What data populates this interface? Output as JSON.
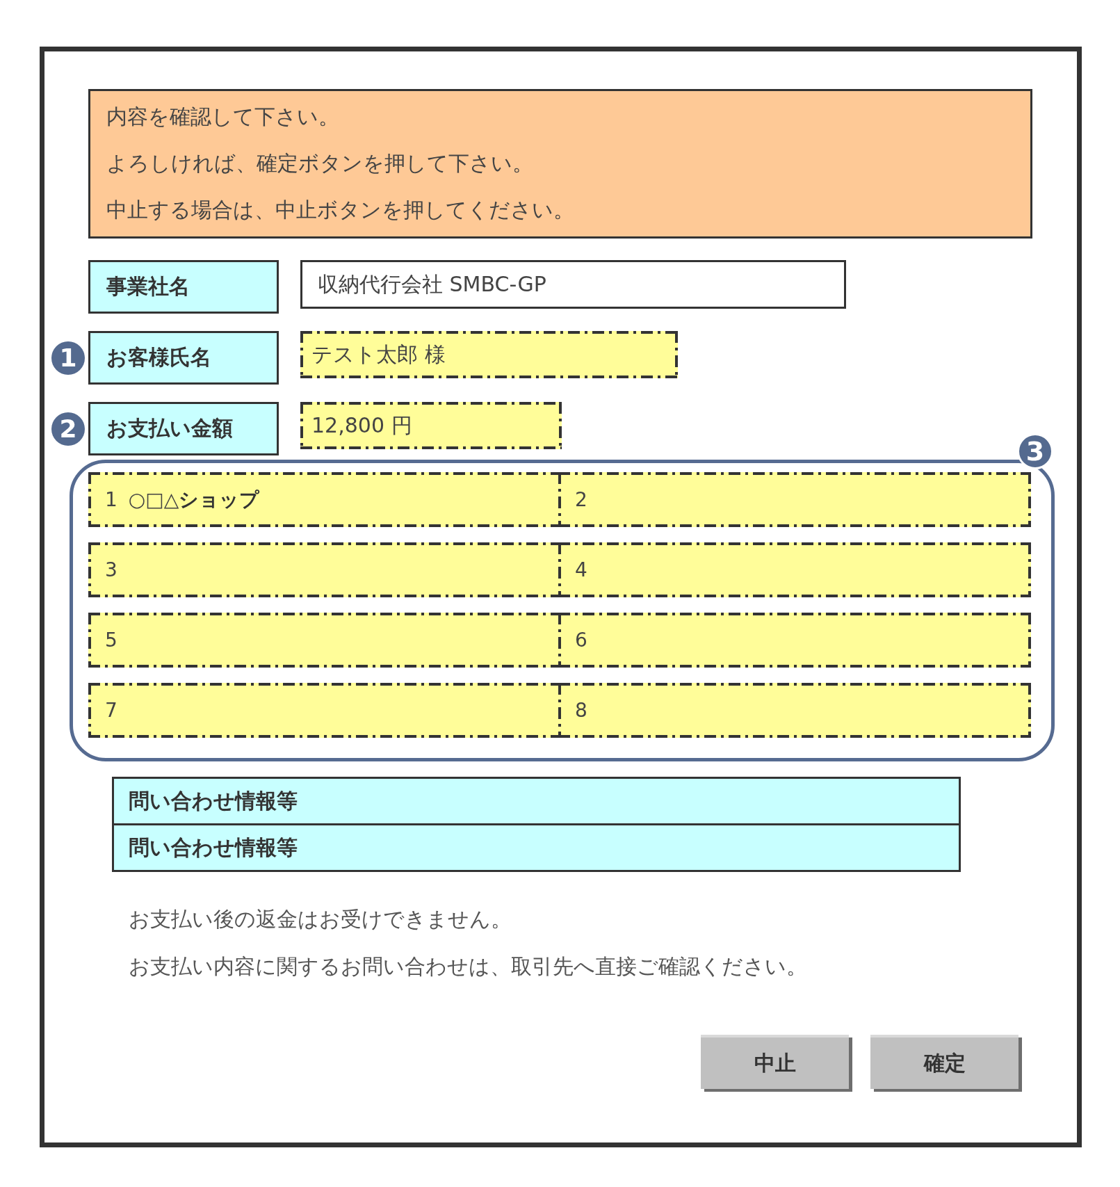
{
  "notice": {
    "lines": [
      "内容を確認して下さい。",
      "よろしければ、確定ボタンを押して下さい。",
      "中止する場合は、中止ボタンを押してください。"
    ]
  },
  "fields": [
    {
      "label": "事業社名",
      "value": "収納代行会社 SMBC-GP",
      "kind": "plain"
    },
    {
      "label": "お客様氏名",
      "value": "テスト太郎 様",
      "kind": "highlight",
      "badge": "1"
    },
    {
      "label": "お支払い金額",
      "value": "12,800 円",
      "kind": "highlight",
      "badge": "2"
    }
  ],
  "shops": {
    "badge": "3",
    "slots": [
      {
        "number": "1",
        "name": "○□△**ショップ**"
      },
      {
        "number": "2"
      },
      {
        "number": "3"
      },
      {
        "number": "4"
      },
      {
        "number": "5"
      },
      {
        "number": "6"
      },
      {
        "number": "7"
      },
      {
        "number": "8"
      }
    ]
  },
  "inquiry": {
    "rows": [
      "問い合わせ情報等",
      "問い合わせ情報等"
    ]
  },
  "notes": [
    "お支払い後の返金はお受けできません。",
    "お支払い内容に関するお問い合わせは、取引先へ直接ご確認ください。"
  ],
  "buttons": [
    {
      "label": "中止"
    },
    {
      "label": "確定"
    }
  ]
}
